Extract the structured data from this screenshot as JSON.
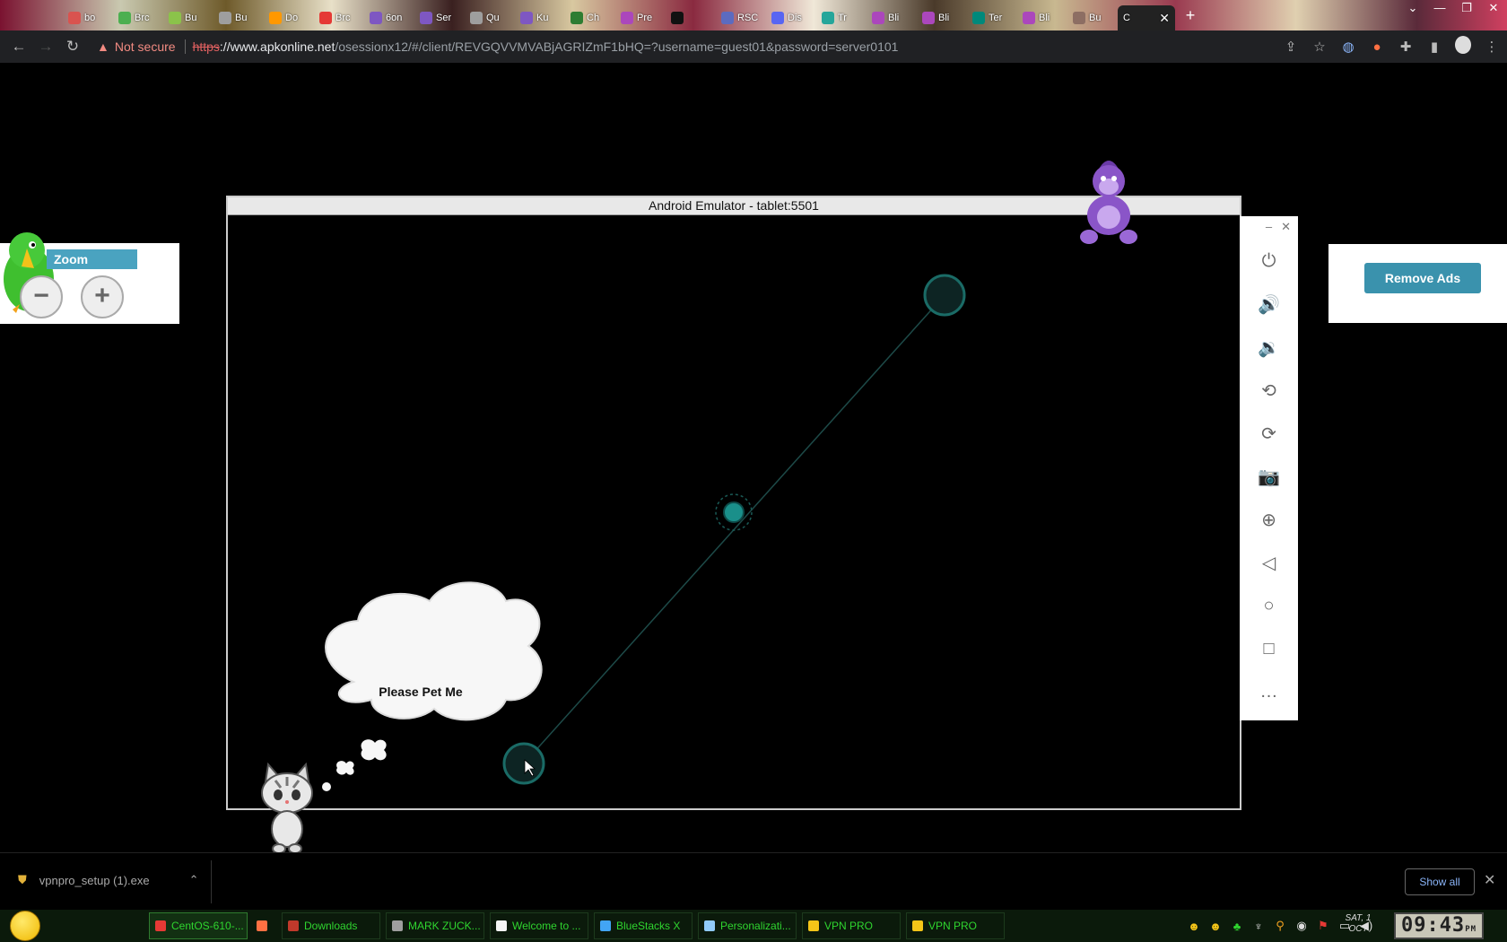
{
  "browser": {
    "tabs": [
      {
        "label": "bo",
        "color": "#d9534f"
      },
      {
        "label": "Brc",
        "color": "#4caf50"
      },
      {
        "label": "Bu",
        "color": "#8bc34a"
      },
      {
        "label": "Bu",
        "color": "#9e9e9e"
      },
      {
        "label": "Do",
        "color": "#ff9800"
      },
      {
        "label": "Brc",
        "color": "#e53935"
      },
      {
        "label": "6on",
        "color": "#7e57c2"
      },
      {
        "label": "Ser",
        "color": "#7e57c2"
      },
      {
        "label": "Qu",
        "color": "#9e9e9e"
      },
      {
        "label": "Ku",
        "color": "#7e57c2"
      },
      {
        "label": "Ch",
        "color": "#2e7d32"
      },
      {
        "label": "Pre",
        "color": "#ab47bc"
      },
      {
        "label": "",
        "color": "#111111"
      },
      {
        "label": "RSC",
        "color": "#5c6bc0"
      },
      {
        "label": "Dis",
        "color": "#5865f2"
      },
      {
        "label": "Tr",
        "color": "#26a69a"
      },
      {
        "label": "Bli",
        "color": "#ab47bc"
      },
      {
        "label": "Bli",
        "color": "#ab47bc"
      },
      {
        "label": "Ter",
        "color": "#00897b"
      },
      {
        "label": "Bli",
        "color": "#ab47bc"
      },
      {
        "label": "Bu",
        "color": "#8d6e63"
      }
    ],
    "active_tab": {
      "label": "C",
      "close": "✕"
    },
    "new_tab": "+",
    "window_controls": [
      "⌄",
      "—",
      "❐",
      "✕"
    ],
    "nav": {
      "back": "←",
      "forward": "→",
      "reload": "↻"
    },
    "security_label": "Not secure",
    "url_scheme": "https",
    "url_host": "://www.apkonline.net",
    "url_path": "/osessionx12/#/client/REVGQVVMVABjAGRIZmF1bHQ=?username=guest01&password=server0101"
  },
  "zoom": {
    "label": "Zoom",
    "minus": "−",
    "plus": "+"
  },
  "ads": {
    "button": "Remove Ads"
  },
  "emulator": {
    "title": "Android Emulator - tablet:5501",
    "bubble_text": "Please Pet Me",
    "accent": "#1a8f8a"
  },
  "side_controls": {
    "minimize": "–",
    "close": "✕",
    "buttons": [
      {
        "name": "power-icon",
        "glyph": "⏻"
      },
      {
        "name": "volume-up-icon",
        "glyph": "🔊"
      },
      {
        "name": "volume-down-icon",
        "glyph": "🔉"
      },
      {
        "name": "rotate-left-icon",
        "glyph": "⟲"
      },
      {
        "name": "rotate-right-icon",
        "glyph": "⟳"
      },
      {
        "name": "camera-icon",
        "glyph": "📷"
      },
      {
        "name": "zoom-icon",
        "glyph": "⊕"
      },
      {
        "name": "back-icon",
        "glyph": "◁"
      },
      {
        "name": "home-icon",
        "glyph": "○"
      },
      {
        "name": "overview-icon",
        "glyph": "□"
      },
      {
        "name": "more-icon",
        "glyph": "…"
      }
    ]
  },
  "downloads": {
    "file": "vpnpro_setup (1).exe",
    "show_all": "Show all",
    "close": "✕"
  },
  "taskbar": {
    "items": [
      {
        "label": "CentOS-610-...",
        "color": "#e53935",
        "active": true
      },
      {
        "label": "",
        "color": "#ff7043",
        "active": false
      },
      {
        "label": "Downloads",
        "color": "#c0392b",
        "active": false
      },
      {
        "label": "MARK ZUCK...",
        "color": "#9e9e9e",
        "active": false
      },
      {
        "label": "Welcome to ...",
        "color": "#f5f5f5",
        "active": false
      },
      {
        "label": "BlueStacks X",
        "color": "#42a5f5",
        "active": false
      },
      {
        "label": "Personalizati...",
        "color": "#90caf9",
        "active": false
      },
      {
        "label": "VPN PRO",
        "color": "#f5c518",
        "active": false
      },
      {
        "label": "VPN PRO",
        "color": "#f5c518",
        "active": false
      }
    ],
    "date_line1": "SAT, 1",
    "date_line2": "OCT",
    "time": "09:43",
    "ampm": "PM"
  }
}
